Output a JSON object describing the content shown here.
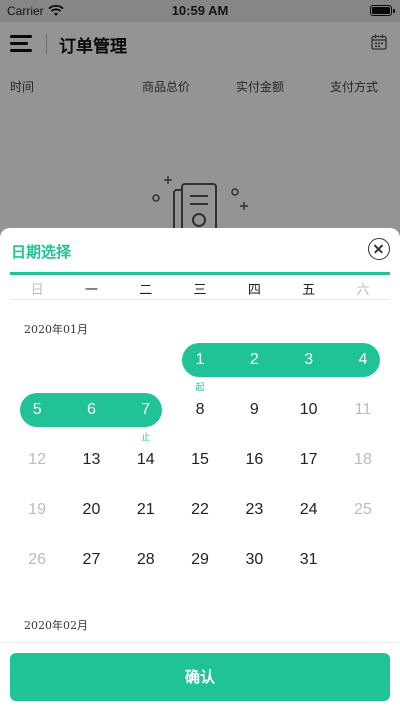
{
  "status_bar": {
    "carrier": "Carrier",
    "time": "10:59 AM"
  },
  "header": {
    "title": "订单管理"
  },
  "columns": [
    "时间",
    "商品总价",
    "实付金额",
    "支付方式"
  ],
  "date_picker": {
    "title": "日期选择",
    "weekdays": [
      "日",
      "一",
      "二",
      "三",
      "四",
      "五",
      "六"
    ],
    "months": [
      {
        "label": "2020年01月",
        "weeks": [
          [
            "",
            "",
            "",
            "1",
            "2",
            "3",
            "4"
          ],
          [
            "5",
            "6",
            "7",
            "8",
            "9",
            "10",
            "11"
          ],
          [
            "12",
            "13",
            "14",
            "15",
            "16",
            "17",
            "18"
          ],
          [
            "19",
            "20",
            "21",
            "22",
            "23",
            "24",
            "25"
          ],
          [
            "26",
            "27",
            "28",
            "29",
            "30",
            "31",
            ""
          ]
        ]
      },
      {
        "label": "2020年02月"
      }
    ],
    "range_start": {
      "day": "1",
      "note": "起"
    },
    "range_end": {
      "day": "7",
      "note": "止"
    }
  },
  "confirm_label": "确认",
  "colors": {
    "accent": "#1fc396",
    "weekend": "#bbbbbb"
  },
  "icons": [
    "menu-icon",
    "calendar-icon",
    "close-icon",
    "wifi-icon",
    "battery-icon",
    "empty-orders-icon"
  ]
}
